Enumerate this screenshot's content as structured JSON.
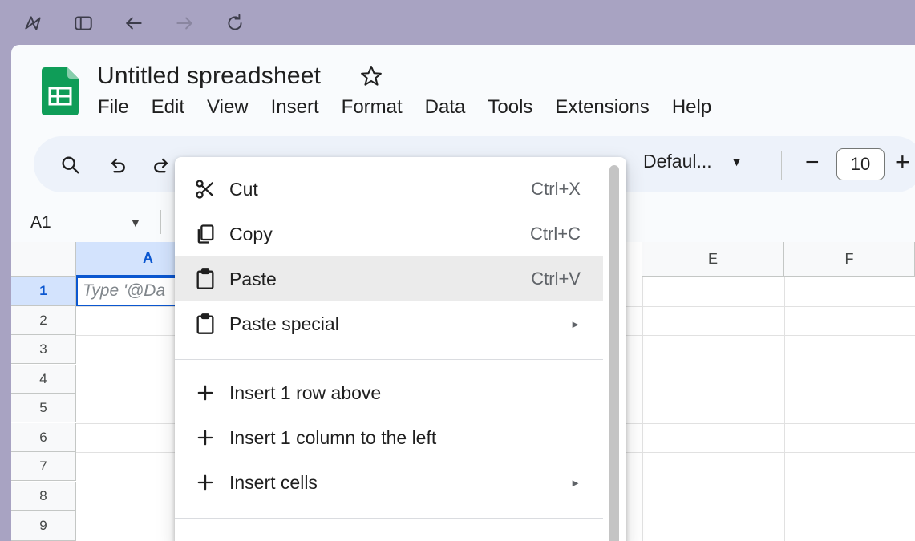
{
  "document": {
    "title": "Untitled spreadsheet"
  },
  "menubar": [
    "File",
    "Edit",
    "View",
    "Insert",
    "Format",
    "Data",
    "Tools",
    "Extensions",
    "Help"
  ],
  "toolbar": {
    "font": "Defaul...",
    "font_size": "10"
  },
  "name_box": "A1",
  "grid": {
    "columns": [
      "A",
      "E",
      "F"
    ],
    "rows": [
      "1",
      "2",
      "3",
      "4",
      "5",
      "6",
      "7",
      "8",
      "9"
    ],
    "cell_a1_hint": "Type '@Da"
  },
  "context_menu": {
    "items": [
      {
        "label": "Cut",
        "shortcut": "Ctrl+X",
        "icon": "scissors-icon"
      },
      {
        "label": "Copy",
        "shortcut": "Ctrl+C",
        "icon": "copy-icon"
      },
      {
        "label": "Paste",
        "shortcut": "Ctrl+V",
        "icon": "clipboard-icon"
      },
      {
        "label": "Paste special",
        "shortcut": "",
        "icon": "clipboard-icon"
      },
      {
        "label": "Insert 1 row above",
        "shortcut": "",
        "icon": "plus-icon"
      },
      {
        "label": "Insert 1 column to the left",
        "shortcut": "",
        "icon": "plus-icon"
      },
      {
        "label": "Insert cells",
        "shortcut": "",
        "icon": "plus-icon"
      }
    ],
    "submenu_arrow": "►"
  },
  "colors": {
    "accent": "#0b57d0",
    "selection_bg": "#d3e3fd",
    "sheets_green": "#0f9d58",
    "chrome_bg": "#a8a3c2"
  }
}
